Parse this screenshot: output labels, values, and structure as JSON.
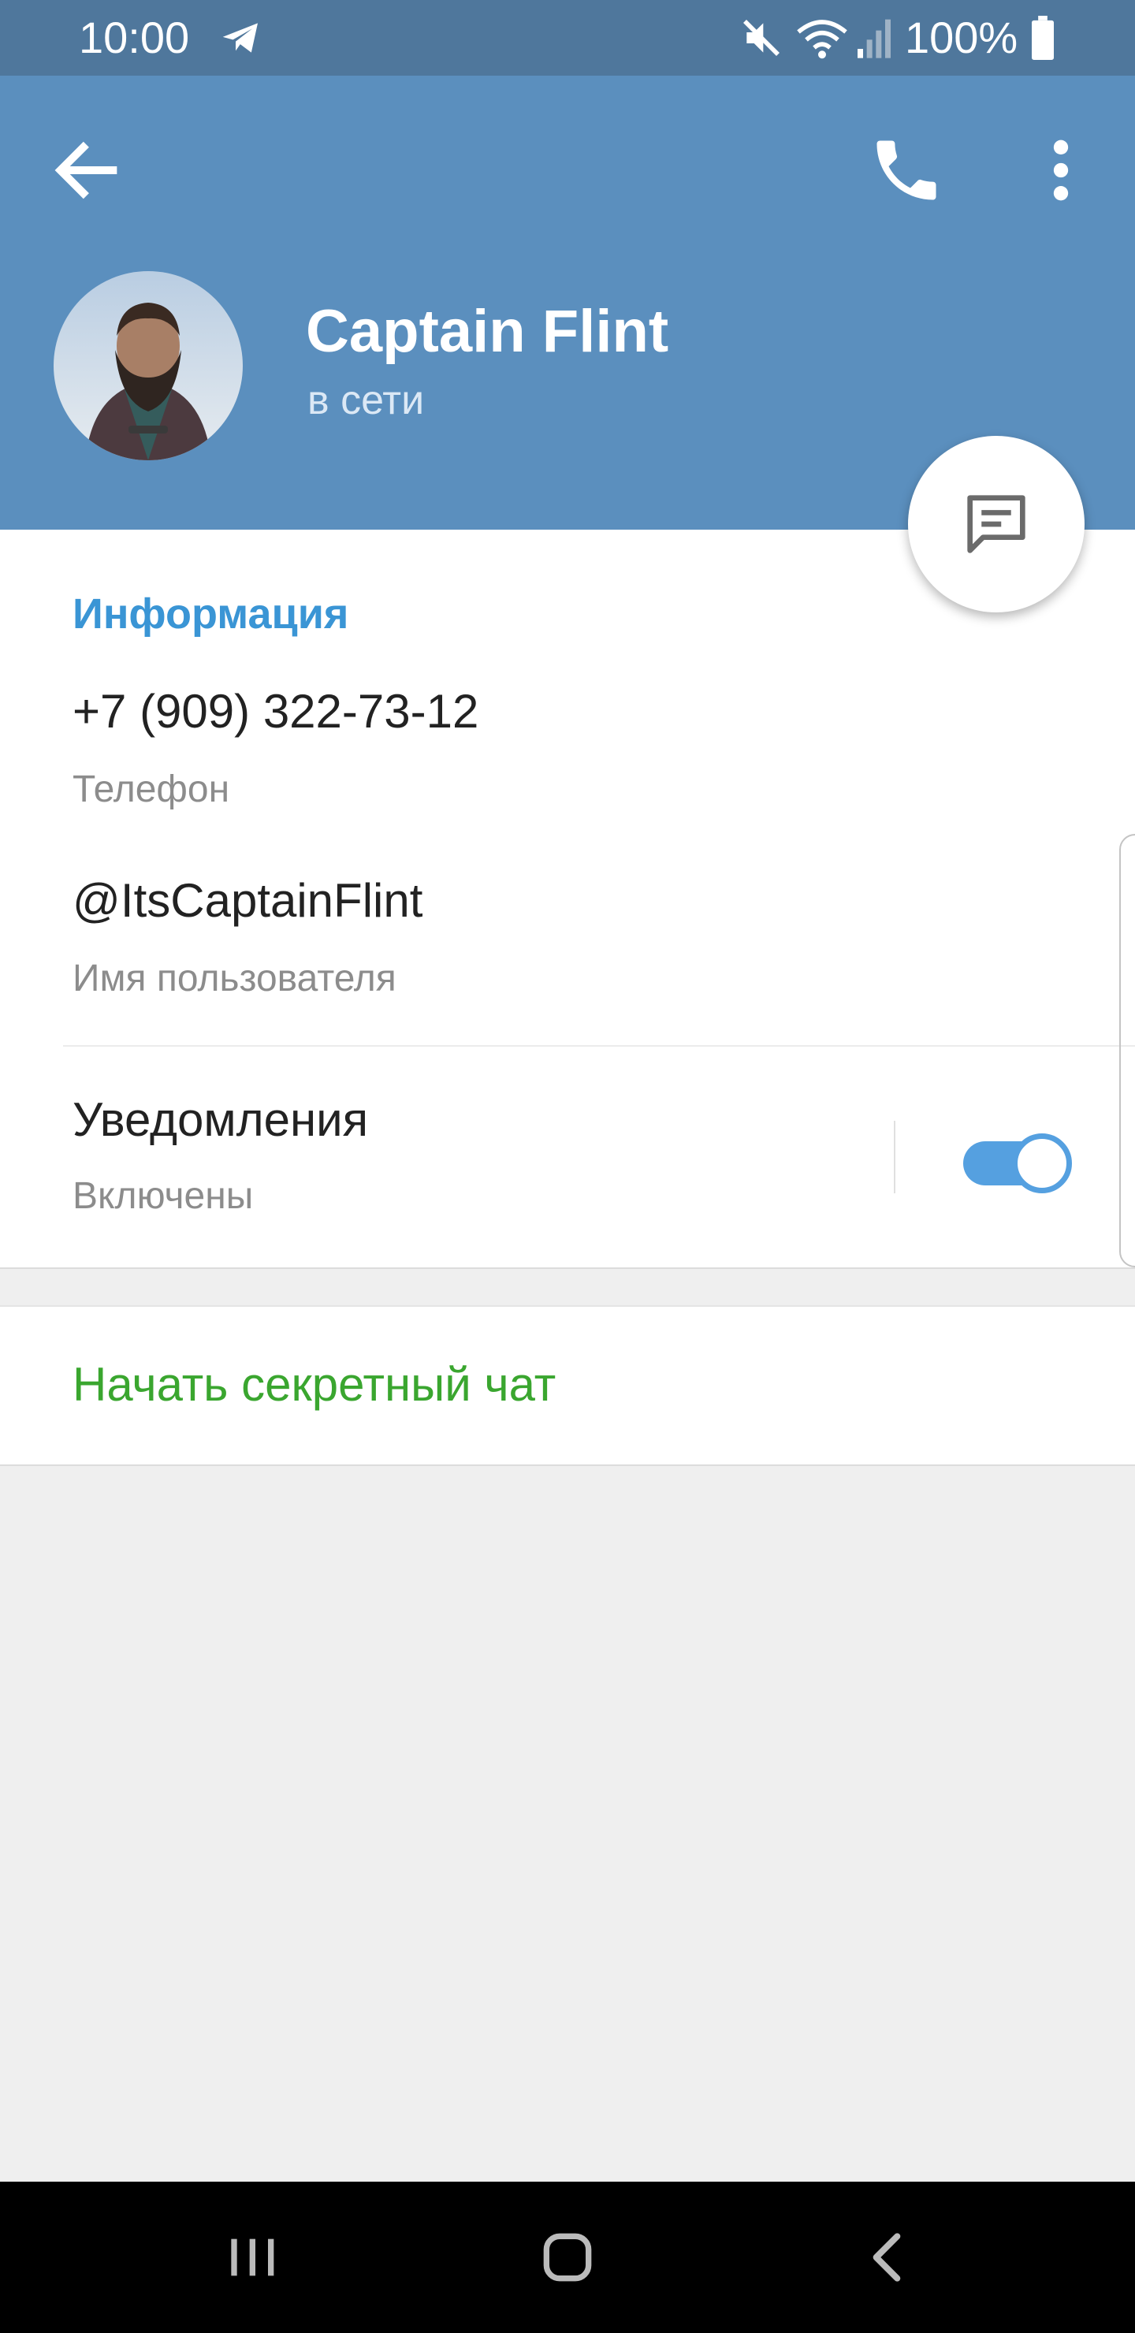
{
  "status_bar": {
    "time": "10:00",
    "battery": "100%",
    "icons": [
      "telegram-icon",
      "mute-icon",
      "wifi-icon",
      "signal-icon",
      "battery-icon"
    ]
  },
  "header": {
    "name": "Captain Flint",
    "status": "в сети",
    "color": "#5b8fbe"
  },
  "info": {
    "title": "Информация",
    "phone": "+7 (909) 322-73-12",
    "phone_label": "Телефон",
    "username": "@ItsCaptainFlint",
    "username_label": "Имя пользователя",
    "notifications": "Уведомления",
    "notifications_state": "Включены",
    "notifications_enabled": true
  },
  "actions": {
    "secret_chat": "Начать секретный чат"
  },
  "colors": {
    "accent": "#3a95d5",
    "secret_chat": "#3aa62f",
    "toggle": "#55a0e0"
  }
}
